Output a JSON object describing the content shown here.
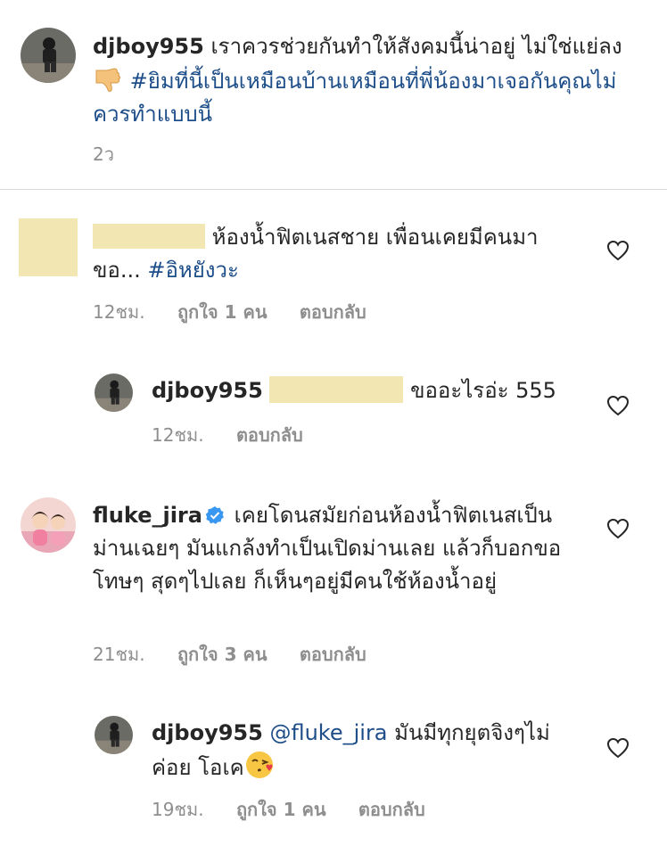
{
  "caption": {
    "username": "djboy955",
    "text": "เราควรช่วยกันทำให้สังคมนี้น่าอยู่ ไม่ใช่แย่ลง",
    "hashtag": "#ยิมที่นี้เป็นเหมือนบ้านเหมือนที่พี่น้องมาเจอกันคุณไม่ควรทำแบบนี้",
    "time": "2ว"
  },
  "comments": [
    {
      "username": "",
      "text": "ห้องน้ำฟิตเนสชาย เพื่อนเคยมีคนมาขอ...",
      "hashtag": "#อิหยังวะ",
      "time": "12ชม.",
      "likes": "ถูกใจ 1 คน",
      "reply": "ตอบกลับ"
    },
    {
      "username": "djboy955",
      "text": "ขออะไรอ่ะ 555",
      "time": "12ชม.",
      "reply": "ตอบกลับ"
    },
    {
      "username": "fluke_jira",
      "text": "เคยโดนสมัยก่อนห้องน้ำฟิตเนสเป็นม่านเฉยๆ มันแกล้งทำเป็นเปิดม่านเลย แล้วก็บอกขอโทษๆ สุดๆไปเลย ก็เห็นๆอยู่มีคนใช้ห้องน้ำอยู่",
      "time": "21ชม.",
      "likes": "ถูกใจ 3 คน",
      "reply": "ตอบกลับ"
    },
    {
      "username": "djboy955",
      "mention": "@fluke_jira",
      "text": "มันมีทุกยุตจิงๆไม่ค่อย โอเค",
      "time": "19ชม.",
      "likes": "ถูกใจ 1 คน",
      "reply": "ตอบกลับ"
    }
  ],
  "colors": {
    "text": "#262626",
    "muted": "#8e8e8e",
    "link": "#1d4e89",
    "redaction": "#f2e6b3",
    "verified": "#3897f0"
  },
  "icons": [
    "heart-outline-icon",
    "verified-badge-icon",
    "thumbs-down-emoji",
    "kissing-face-emoji"
  ]
}
